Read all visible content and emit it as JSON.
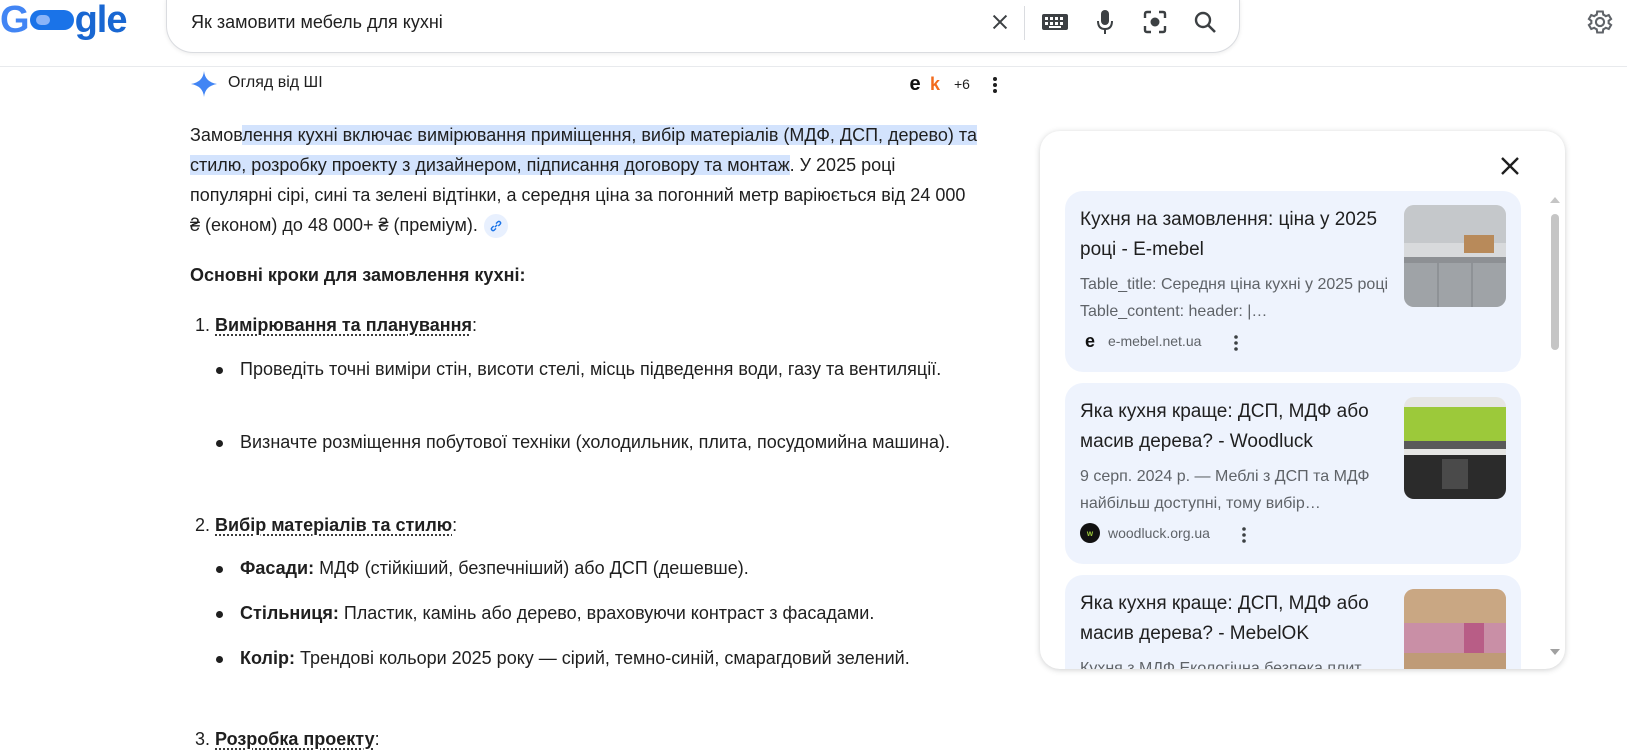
{
  "header": {
    "logo_text": "Google",
    "search_query": "Як замовити мебель для кухні",
    "icons": [
      "close-icon",
      "keyboard-icon",
      "mic-icon",
      "lens-icon",
      "search-icon",
      "settings-icon"
    ]
  },
  "ai_overview": {
    "title": "Огляд від ШІ",
    "source_count": "+6",
    "answer_prefix": "Замов",
    "answer_highlight": "лення кухні включає вимірювання приміщення, вибір матеріалів (МДФ, ДСП, дерево) та стилю, розробку проекту з дизайнером, підписання договору та монтаж",
    "answer_rest": ". У 2025 році популярні сірі, сині та зелені відтінки, а середня ціна за погонний метр варіюється від 24 000 ₴ (економ) до 48 000+ ₴ (преміум).",
    "steps_heading": "Основні кроки для замовлення кухні:",
    "steps": [
      {
        "num": "1.",
        "title": "Вимірювання та планування",
        "bullets": [
          {
            "bold": "",
            "text": "Проведіть точні виміри стін, висоти стелі, місць підведення води, газу та вентиляції."
          },
          {
            "bold": "",
            "text": "Визначте розміщення побутової техніки (холодильник, плита, посудомийна машина)."
          }
        ]
      },
      {
        "num": "2.",
        "title": "Вибір матеріалів та стилю",
        "bullets": [
          {
            "bold": "Фасади:",
            "text": " МДФ (стійкіший, безпечніший) або ДСП (дешевше)."
          },
          {
            "bold": "Стільниця:",
            "text": " Пластик, камінь або дерево, враховуючи контраст з фасадами."
          },
          {
            "bold": "Колір:",
            "text": " Трендові кольори 2025 року — сірий, темно-синій, смарагдовий зелений."
          }
        ]
      },
      {
        "num": "3.",
        "title": "Розробка проекту",
        "bullets": []
      }
    ]
  },
  "sources_panel": {
    "cards": [
      {
        "title": "Кухня на замовлення: ціна у 2025 році - E-mebel",
        "snippet": "Table_title: Середня ціна кухні у 2025 році Table_content: header: |…",
        "site": "e-mebel.net.ua",
        "thumb_color": "#b9bcbf"
      },
      {
        "title": "Яка кухня краще: ДСП, МДФ або масив дерева? - Woodluck",
        "snippet": "9 серп. 2024 р. — Меблі з ДСП та МДФ найбільш доступні, тому вибір…",
        "site": "woodluck.org.ua",
        "thumb_color": "#9cc93a"
      },
      {
        "title": "Яка кухня краще: ДСП, МДФ або масив дерева? - MebelOK",
        "snippet": "Кухня з МДФ Екологічна безпека плит",
        "site": "",
        "thumb_color": "#c98fa6"
      }
    ]
  },
  "colors": {
    "highlight": "#d3e3fd",
    "card_bg": "#eef3fd",
    "accent": "#1a73e8"
  }
}
